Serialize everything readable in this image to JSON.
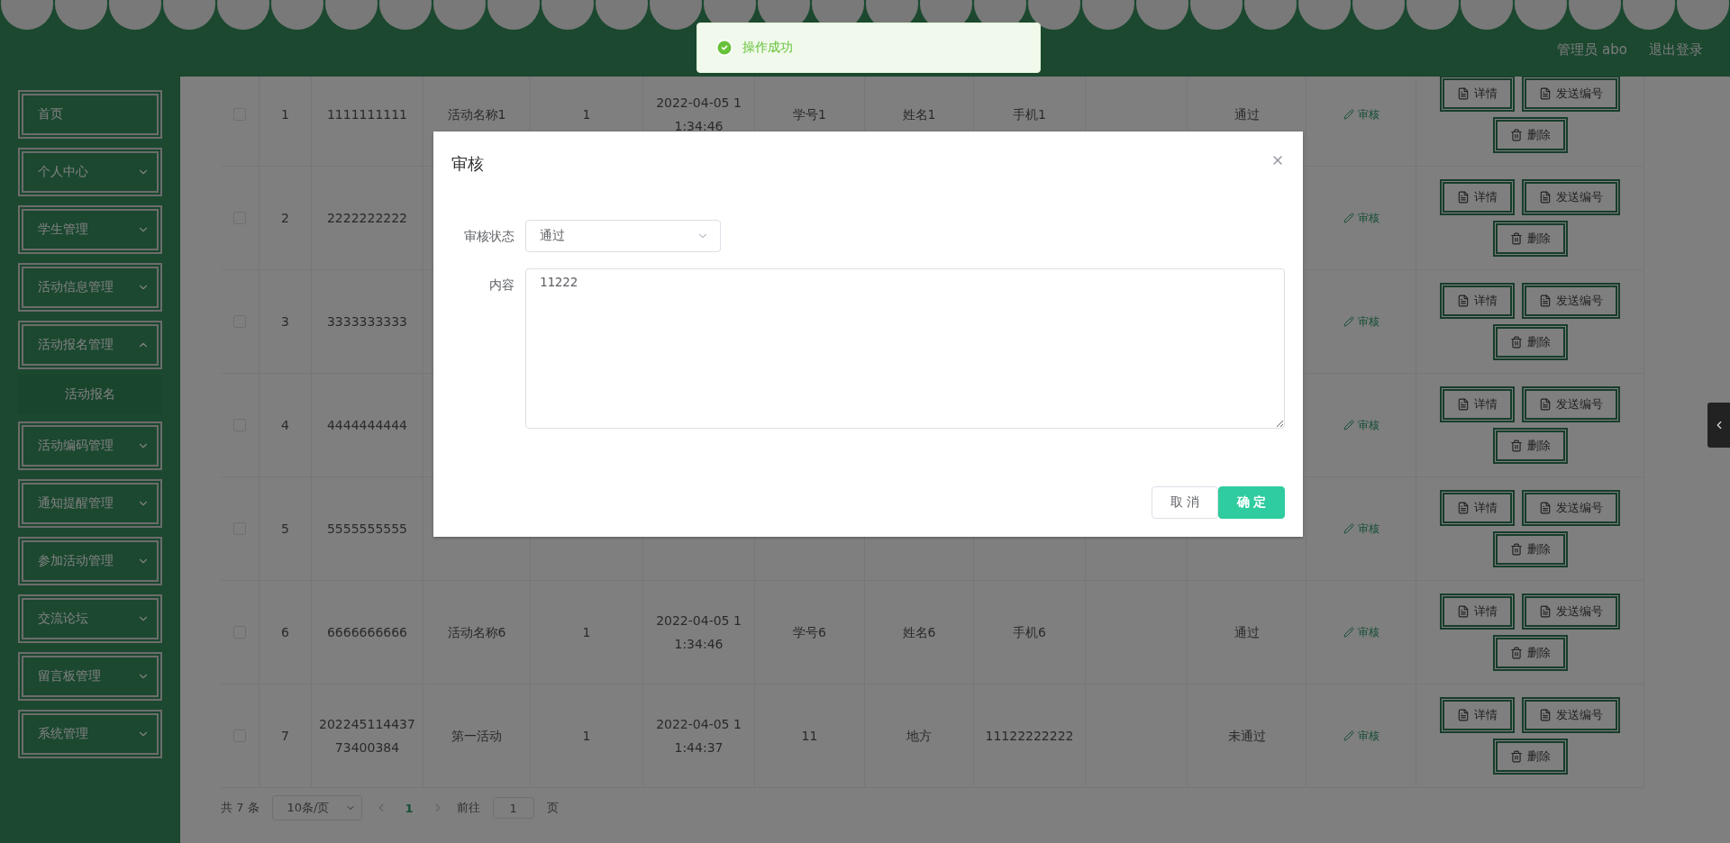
{
  "header": {
    "user": "管理员 abo",
    "logout": "退出登录"
  },
  "toast": {
    "kind": "success",
    "message": "操作成功"
  },
  "sidebar": {
    "items": [
      {
        "label": "首页",
        "kind": "link"
      },
      {
        "label": "个人中心",
        "kind": "submenu",
        "expanded": false
      },
      {
        "label": "学生管理",
        "kind": "submenu",
        "expanded": false
      },
      {
        "label": "活动信息管理",
        "kind": "submenu",
        "expanded": false
      },
      {
        "label": "活动报名管理",
        "kind": "submenu",
        "expanded": true,
        "children": [
          {
            "label": "活动报名"
          }
        ]
      },
      {
        "label": "活动编码管理",
        "kind": "submenu",
        "expanded": false
      },
      {
        "label": "通知提醒管理",
        "kind": "submenu",
        "expanded": false
      },
      {
        "label": "参加活动管理",
        "kind": "submenu",
        "expanded": false
      },
      {
        "label": "交流论坛",
        "kind": "submenu",
        "expanded": false
      },
      {
        "label": "留言板管理",
        "kind": "submenu",
        "expanded": false
      },
      {
        "label": "系统管理",
        "kind": "submenu",
        "expanded": false
      }
    ]
  },
  "table": {
    "rows": [
      {
        "checked": false,
        "index": "1",
        "number": "1111111111",
        "activity_name": "活动名称1",
        "count": "1",
        "time": "2022-04-05 11:34:46",
        "student_id": "学号1",
        "student_name": "姓名1",
        "phone": "手机1",
        "status": "通过",
        "audit": "审核",
        "actions": [
          "详情",
          "发送编号",
          "删除"
        ]
      },
      {
        "checked": false,
        "index": "2",
        "number": "2222222222",
        "audit": "审核",
        "actions": [
          "详情",
          "发送编号",
          "删除"
        ]
      },
      {
        "checked": false,
        "index": "3",
        "number": "3333333333",
        "audit": "审核",
        "actions": [
          "详情",
          "发送编号",
          "删除"
        ]
      },
      {
        "checked": false,
        "index": "4",
        "number": "4444444444",
        "audit": "审核",
        "actions": [
          "详情",
          "发送编号",
          "删除"
        ]
      },
      {
        "checked": false,
        "index": "5",
        "number": "5555555555",
        "audit": "审核",
        "actions": [
          "详情",
          "发送编号",
          "删除"
        ]
      },
      {
        "checked": false,
        "index": "6",
        "number": "6666666666",
        "activity_name": "活动名称6",
        "count": "1",
        "time": "2022-04-05 11:34:46",
        "student_id": "学号6",
        "student_name": "姓名6",
        "phone": "手机6",
        "status": "通过",
        "audit": "审核",
        "actions": [
          "详情",
          "发送编号",
          "删除"
        ]
      },
      {
        "checked": false,
        "index": "7",
        "number": "20224511443773400384",
        "activity_name": "第一活动",
        "count": "1",
        "time": "2022-04-05 11:44:37",
        "student_id": "11",
        "student_name": "地方",
        "phone": "11122222222",
        "status": "未通过",
        "audit": "审核",
        "actions": [
          "详情",
          "发送编号",
          "删除"
        ]
      }
    ]
  },
  "pagination": {
    "total": "共 7 条",
    "page_size": "10条/页",
    "pages": [
      {
        "label": "1",
        "selected": true
      }
    ],
    "goto_label": "前往",
    "goto_value": "1",
    "goto_suffix": "页"
  },
  "dialog": {
    "title": "审核",
    "fields": [
      {
        "kind": "select",
        "label": "审核状态",
        "value": "通过"
      },
      {
        "kind": "textarea",
        "label": "内容",
        "value": "11222"
      }
    ],
    "buttons": [
      {
        "label": "取 消",
        "kind": "default"
      },
      {
        "label": "确 定",
        "kind": "primary"
      }
    ]
  }
}
